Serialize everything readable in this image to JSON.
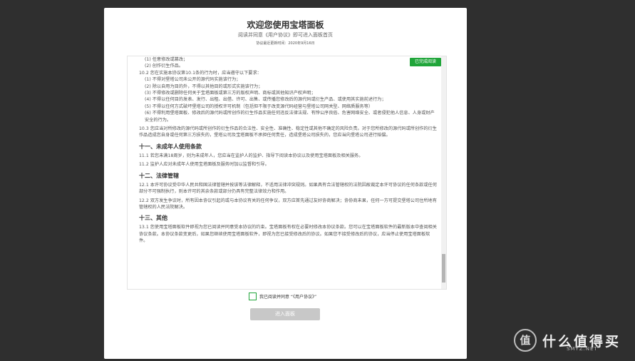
{
  "dialog": {
    "title": "欢迎您使用宝塔面板",
    "subtitle": "阅读并同意《用户协议》即可进入面板首页",
    "update_label": "协议最近更新时间：2020年9月16日"
  },
  "agreement": {
    "badge": "已完成阅读",
    "lines": [
      {
        "text": "(1) 任意修改或篡改；",
        "indent": true
      },
      {
        "text": "(2) 创作衍生作品。",
        "indent": true
      },
      {
        "text": "10.2 您在实施本协议第10.1条的行为时，应当遵守以下要求：",
        "indent": false
      },
      {
        "text": "(1) 不得对堡塔公司未公开的源代码实施该行为；",
        "indent": true
      },
      {
        "text": "(2) 除以自用为目的外，不得以其他目的或形式实施该行为；",
        "indent": true
      },
      {
        "text": "(3) 不得修改或删除任何关于宝塔面板或第三方的版权声明、商标或其他知识产权声明；",
        "indent": true
      },
      {
        "text": "(4) 不得以任何目的发表、发行、出租、出借、许可、出售、或传播您修改后的源代码或衍生产品、或使用其实施前述行为；",
        "indent": true
      },
      {
        "text": "(5) 不得以任何方式破坏堡塔公司的授权许可机制（包括但不限于改变源代码经营与堡塔公司网关型、网络质服务等）",
        "indent": true
      },
      {
        "text": "(6) 不得利用堡塔面板、修改后的源代码或所创作的衍生作品实施任何违反法律法规、有悖公序良俗、危害网络安全、或者侵犯他人信息、人身或财产安全的行为。",
        "indent": true
      },
      {
        "text": "10.3 您应当对所修改的源代码或所创作的衍生作品的合法性、安全性、准确性、稳定性或其他不确定的风险负责。对于您所修改的源代码或所创作的衍生作品造成您自身或任何第三方损失的，堡塔公司及宝塔面板不承担任何责任，造成堡塔公司损失的，您应当向堡塔公司进行赔偿。",
        "indent": false,
        "gap": true
      }
    ],
    "sections": [
      {
        "heading": "十一、未成年人使用条款",
        "paragraphs": [
          "11.1 若您未满18周岁，则为未成年人，您应当在监护人的监护、指导下阅读本协议以及使用宝塔面板及相关服务。",
          "11.2 监护人应对未成年人使用宝塔面板及服务时加以监督和引导。"
        ]
      },
      {
        "heading": "十二、法律管辖",
        "paragraphs": [
          "12.1 本许可协议受中华人民共和国法律管辖并按该等法律解释，不适用法律冲突规则。如果具有合法管辖权的法院因故裁定本许可协议的任何条款或任何部分不可强制执行，则本许可的其余条款或部分仍具有完整法律效力和作用。",
          "12.2 双方发生争议时，所有因本协议引起的或与本协议有关的任何争议，双方应首先通过友好协商解决；协协商未果，任何一方可提交堡塔公司住所地有管辖权的人民法院解决。"
        ]
      },
      {
        "heading": "十三、其他",
        "paragraphs": [
          "13.1 您使用宝塔面板软件即视为您已阅读并同意受本协议的约束。宝塔面板有权在必要时修改本协议条款。您可以在宝塔面板软件的最新版本中查阅相关协议条款。本协议条款变更后，如果您继续使用宝塔面板软件，即视为您已接受修改后的协议。如果您不接受修改后的协议，应当停止使用宝塔面板软件。"
        ]
      }
    ]
  },
  "agree_checkbox": {
    "label": "我已阅读并同意 “《用户协议》”",
    "checked": false
  },
  "enter_button": {
    "label": "进入面板"
  },
  "watermark": {
    "logo_char": "值",
    "text": "什么值得买",
    "url": "SMYZ.NET"
  },
  "colors": {
    "accent": "#20a53a",
    "button_disabled": "#c8c8c8",
    "backdrop": "#2f2f2f"
  }
}
